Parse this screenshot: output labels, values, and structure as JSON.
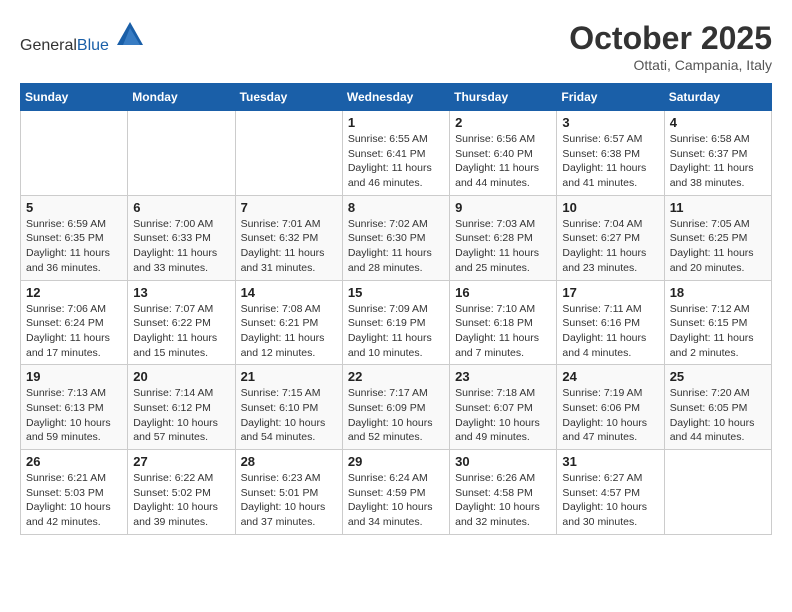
{
  "header": {
    "logo_general": "General",
    "logo_blue": "Blue",
    "title": "October 2025",
    "subtitle": "Ottati, Campania, Italy"
  },
  "days_of_week": [
    "Sunday",
    "Monday",
    "Tuesday",
    "Wednesday",
    "Thursday",
    "Friday",
    "Saturday"
  ],
  "weeks": [
    [
      {
        "day": "",
        "info": ""
      },
      {
        "day": "",
        "info": ""
      },
      {
        "day": "",
        "info": ""
      },
      {
        "day": "1",
        "info": "Sunrise: 6:55 AM\nSunset: 6:41 PM\nDaylight: 11 hours\nand 46 minutes."
      },
      {
        "day": "2",
        "info": "Sunrise: 6:56 AM\nSunset: 6:40 PM\nDaylight: 11 hours\nand 44 minutes."
      },
      {
        "day": "3",
        "info": "Sunrise: 6:57 AM\nSunset: 6:38 PM\nDaylight: 11 hours\nand 41 minutes."
      },
      {
        "day": "4",
        "info": "Sunrise: 6:58 AM\nSunset: 6:37 PM\nDaylight: 11 hours\nand 38 minutes."
      }
    ],
    [
      {
        "day": "5",
        "info": "Sunrise: 6:59 AM\nSunset: 6:35 PM\nDaylight: 11 hours\nand 36 minutes."
      },
      {
        "day": "6",
        "info": "Sunrise: 7:00 AM\nSunset: 6:33 PM\nDaylight: 11 hours\nand 33 minutes."
      },
      {
        "day": "7",
        "info": "Sunrise: 7:01 AM\nSunset: 6:32 PM\nDaylight: 11 hours\nand 31 minutes."
      },
      {
        "day": "8",
        "info": "Sunrise: 7:02 AM\nSunset: 6:30 PM\nDaylight: 11 hours\nand 28 minutes."
      },
      {
        "day": "9",
        "info": "Sunrise: 7:03 AM\nSunset: 6:28 PM\nDaylight: 11 hours\nand 25 minutes."
      },
      {
        "day": "10",
        "info": "Sunrise: 7:04 AM\nSunset: 6:27 PM\nDaylight: 11 hours\nand 23 minutes."
      },
      {
        "day": "11",
        "info": "Sunrise: 7:05 AM\nSunset: 6:25 PM\nDaylight: 11 hours\nand 20 minutes."
      }
    ],
    [
      {
        "day": "12",
        "info": "Sunrise: 7:06 AM\nSunset: 6:24 PM\nDaylight: 11 hours\nand 17 minutes."
      },
      {
        "day": "13",
        "info": "Sunrise: 7:07 AM\nSunset: 6:22 PM\nDaylight: 11 hours\nand 15 minutes."
      },
      {
        "day": "14",
        "info": "Sunrise: 7:08 AM\nSunset: 6:21 PM\nDaylight: 11 hours\nand 12 minutes."
      },
      {
        "day": "15",
        "info": "Sunrise: 7:09 AM\nSunset: 6:19 PM\nDaylight: 11 hours\nand 10 minutes."
      },
      {
        "day": "16",
        "info": "Sunrise: 7:10 AM\nSunset: 6:18 PM\nDaylight: 11 hours\nand 7 minutes."
      },
      {
        "day": "17",
        "info": "Sunrise: 7:11 AM\nSunset: 6:16 PM\nDaylight: 11 hours\nand 4 minutes."
      },
      {
        "day": "18",
        "info": "Sunrise: 7:12 AM\nSunset: 6:15 PM\nDaylight: 11 hours\nand 2 minutes."
      }
    ],
    [
      {
        "day": "19",
        "info": "Sunrise: 7:13 AM\nSunset: 6:13 PM\nDaylight: 10 hours\nand 59 minutes."
      },
      {
        "day": "20",
        "info": "Sunrise: 7:14 AM\nSunset: 6:12 PM\nDaylight: 10 hours\nand 57 minutes."
      },
      {
        "day": "21",
        "info": "Sunrise: 7:15 AM\nSunset: 6:10 PM\nDaylight: 10 hours\nand 54 minutes."
      },
      {
        "day": "22",
        "info": "Sunrise: 7:17 AM\nSunset: 6:09 PM\nDaylight: 10 hours\nand 52 minutes."
      },
      {
        "day": "23",
        "info": "Sunrise: 7:18 AM\nSunset: 6:07 PM\nDaylight: 10 hours\nand 49 minutes."
      },
      {
        "day": "24",
        "info": "Sunrise: 7:19 AM\nSunset: 6:06 PM\nDaylight: 10 hours\nand 47 minutes."
      },
      {
        "day": "25",
        "info": "Sunrise: 7:20 AM\nSunset: 6:05 PM\nDaylight: 10 hours\nand 44 minutes."
      }
    ],
    [
      {
        "day": "26",
        "info": "Sunrise: 6:21 AM\nSunset: 5:03 PM\nDaylight: 10 hours\nand 42 minutes."
      },
      {
        "day": "27",
        "info": "Sunrise: 6:22 AM\nSunset: 5:02 PM\nDaylight: 10 hours\nand 39 minutes."
      },
      {
        "day": "28",
        "info": "Sunrise: 6:23 AM\nSunset: 5:01 PM\nDaylight: 10 hours\nand 37 minutes."
      },
      {
        "day": "29",
        "info": "Sunrise: 6:24 AM\nSunset: 4:59 PM\nDaylight: 10 hours\nand 34 minutes."
      },
      {
        "day": "30",
        "info": "Sunrise: 6:26 AM\nSunset: 4:58 PM\nDaylight: 10 hours\nand 32 minutes."
      },
      {
        "day": "31",
        "info": "Sunrise: 6:27 AM\nSunset: 4:57 PM\nDaylight: 10 hours\nand 30 minutes."
      },
      {
        "day": "",
        "info": ""
      }
    ]
  ]
}
